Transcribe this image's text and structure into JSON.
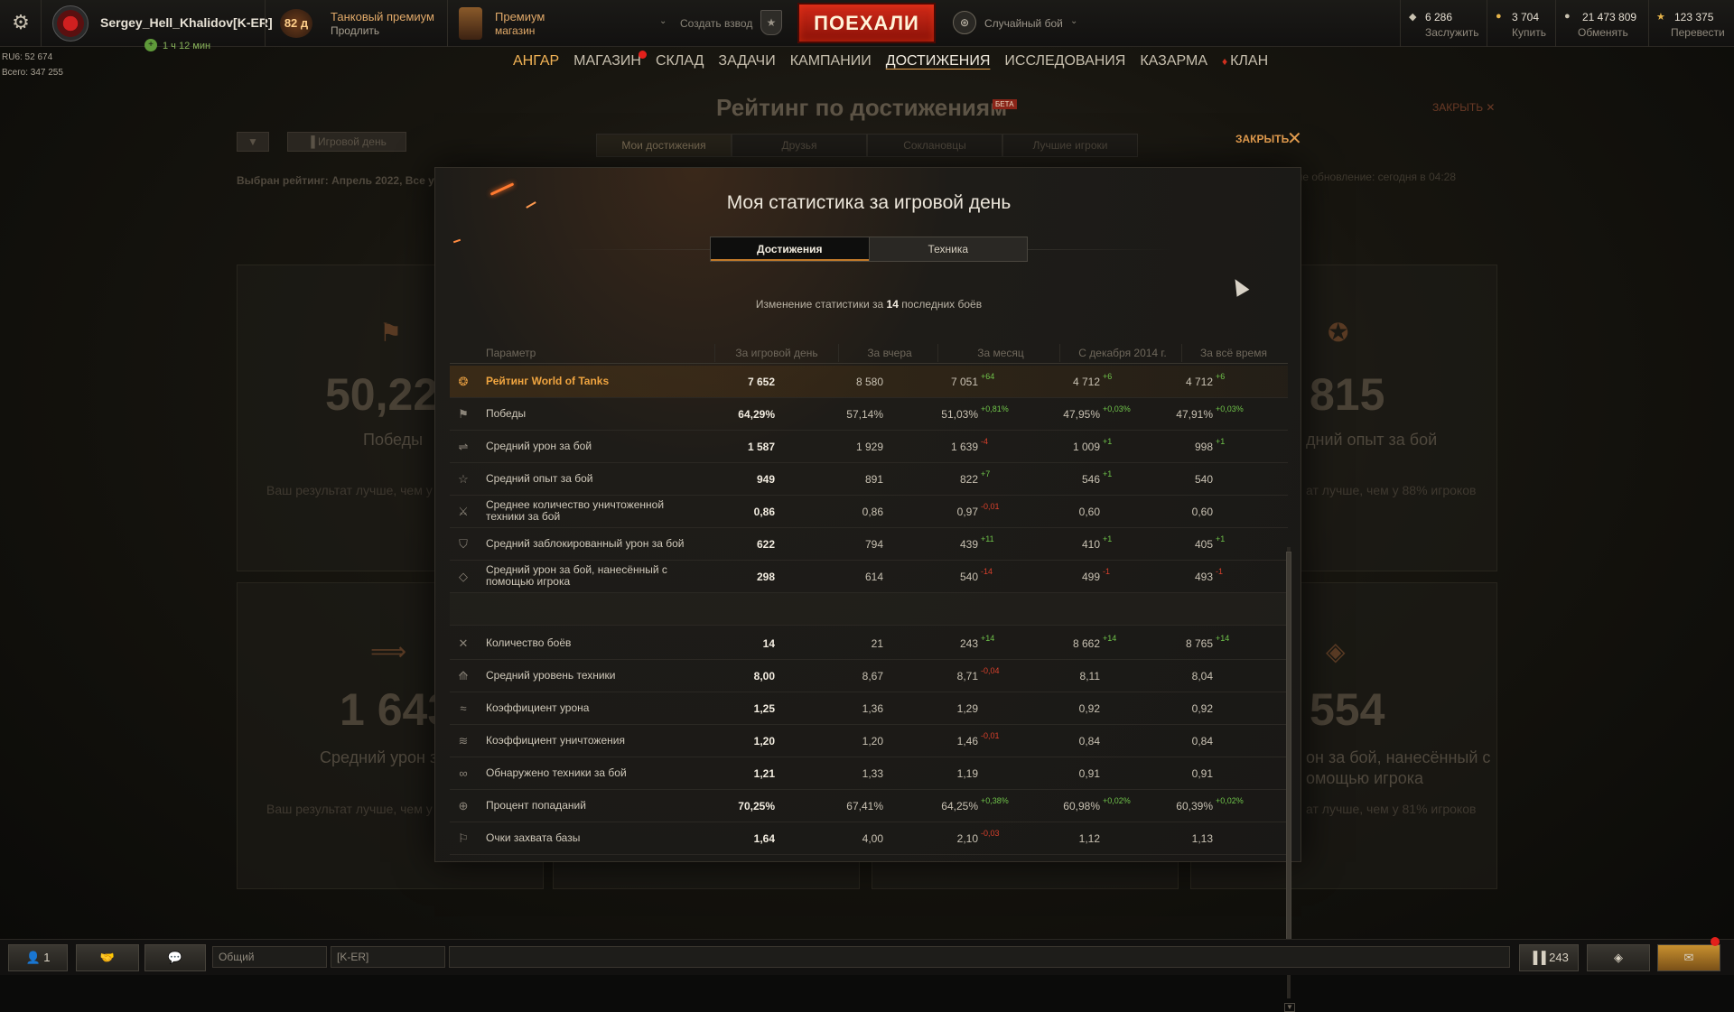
{
  "topbar": {
    "player_name": "Sergey_Hell_Khalidov[K-ER]",
    "premium_timer": "1 ч 12 мин",
    "premium_days": "82 д",
    "premium_title": "Танковый премиум",
    "premium_extend": "Продлить",
    "shop_title": "Премиум",
    "shop_sub": "магазин",
    "platoon_label": "Создать взвод",
    "battle_button": "ПОЕХАЛИ",
    "battle_mode": "Случайный бой",
    "currencies": [
      {
        "icon": "bonds-icon",
        "value": "6 286",
        "action": "Заслужить",
        "color": "#c9c2b0"
      },
      {
        "icon": "gold-icon",
        "value": "3 704",
        "action": "Купить",
        "color": "#e5b34a"
      },
      {
        "icon": "credits-icon",
        "value": "21 473 809",
        "action": "Обменять",
        "color": "#c9c2b0"
      },
      {
        "icon": "free-xp-icon",
        "value": "123 375",
        "action": "Перевести",
        "color": "#e5b34a"
      }
    ]
  },
  "ratings": {
    "line1": "RU6: 52 674",
    "line2": "Всего: 347 255"
  },
  "nav": [
    "АНГАР",
    "МАГАЗИН",
    "СКЛАД",
    "ЗАДАЧИ",
    "КАМПАНИИ",
    "ДОСТИЖЕНИЯ",
    "ИССЛЕДОВАНИЯ",
    "КАЗАРМА",
    "КЛАН"
  ],
  "background_page": {
    "title": "Рейтинг по достижениям",
    "beta": "БЕТА",
    "close": "ЗАКРЫТЬ",
    "day_tab": "Игровой день",
    "subtabs": [
      "Мои достижения",
      "Друзья",
      "Соклановцы",
      "Лучшие игроки"
    ],
    "selected_rating": "Выбран рейтинг: Апрель 2022, Все ур",
    "last_update": "дние обновление: сегодня в 04:28",
    "cards": [
      {
        "number": "50,22%",
        "label": "Победы",
        "sub": "Ваш результат лучше, чем у"
      },
      {
        "number": "815",
        "label": "дний опыт за бой",
        "sub": "ат лучше, чем у 88% игроков"
      },
      {
        "number": "1 643",
        "label": "Средний урон за",
        "sub": "Ваш результат лучше, чем у"
      },
      {
        "number": "554",
        "label": "он за бой, нанесённый с",
        "label2": "омощью игрока",
        "sub": "ат лучше, чем у 81% игроков"
      }
    ]
  },
  "modal": {
    "close_label": "ЗАКРЫТЬ",
    "title": "Моя статистика за игровой день",
    "tabs": [
      "Достижения",
      "Техника"
    ],
    "change_prefix": "Изменение статистики за ",
    "change_count": "14",
    "change_suffix": " последних боёв",
    "columns": [
      "Параметр",
      "За игровой день",
      "За вчера",
      "За месяц",
      "С декабря 2014 г.",
      "За всё время"
    ],
    "rows": [
      {
        "icon": "wot-rating-icon",
        "label": "Рейтинг World of Tanks",
        "day": "7 652",
        "yesterday": "8 580",
        "month": "7 051",
        "month_d": "+64",
        "since": "4 712",
        "since_d": "+6",
        "all": "4 712",
        "all_d": "+6",
        "highlight": true
      },
      {
        "icon": "flag-icon",
        "label": "Победы",
        "day": "64,29%",
        "yesterday": "57,14%",
        "month": "51,03%",
        "month_d": "+0,81%",
        "since": "47,95%",
        "since_d": "+0,03%",
        "all": "47,91%",
        "all_d": "+0,03%"
      },
      {
        "icon": "damage-icon",
        "label": "Средний урон за бой",
        "day": "1 587",
        "yesterday": "1 929",
        "month": "1 639",
        "month_d": "-4",
        "since": "1 009",
        "since_d": "+1",
        "all": "998",
        "all_d": "+1"
      },
      {
        "icon": "star-icon",
        "label": "Средний опыт за бой",
        "day": "949",
        "yesterday": "891",
        "month": "822",
        "month_d": "+7",
        "since": "546",
        "since_d": "+1",
        "all": "540",
        "all_d": ""
      },
      {
        "icon": "destroyed-tank-icon",
        "label": "Среднее количество уничтоженной техники за бой",
        "day": "0,86",
        "yesterday": "0,86",
        "month": "0,97",
        "month_d": "-0,01",
        "since": "0,60",
        "since_d": "",
        "all": "0,60",
        "all_d": ""
      },
      {
        "icon": "shield-icon",
        "label": "Средний заблокированный урон за бой",
        "day": "622",
        "yesterday": "794",
        "month": "439",
        "month_d": "+11",
        "since": "410",
        "since_d": "+1",
        "all": "405",
        "all_d": "+1"
      },
      {
        "icon": "assist-icon",
        "label": "Средний урон за бой, нанесённый с помощью игрока",
        "day": "298",
        "yesterday": "614",
        "month": "540",
        "month_d": "-14",
        "since": "499",
        "since_d": "-1",
        "all": "493",
        "all_d": "-1"
      },
      {
        "icon": "battles-icon",
        "label": "Количество боёв",
        "day": "14",
        "yesterday": "21",
        "month": "243",
        "month_d": "+14",
        "since": "8 662",
        "since_d": "+14",
        "all": "8 765",
        "all_d": "+14"
      },
      {
        "icon": "tier-icon",
        "label": "Средний уровень техники",
        "day": "8,00",
        "yesterday": "8,67",
        "month": "8,71",
        "month_d": "-0,04",
        "since": "8,11",
        "since_d": "",
        "all": "8,04",
        "all_d": ""
      },
      {
        "icon": "damage-ratio-icon",
        "label": "Коэффициент урона",
        "day": "1,25",
        "yesterday": "1,36",
        "month": "1,29",
        "month_d": "",
        "since": "0,92",
        "since_d": "",
        "all": "0,92",
        "all_d": ""
      },
      {
        "icon": "kill-ratio-icon",
        "label": "Коэффициент уничтожения",
        "day": "1,20",
        "yesterday": "1,20",
        "month": "1,46",
        "month_d": "-0,01",
        "since": "0,84",
        "since_d": "",
        "all": "0,84",
        "all_d": ""
      },
      {
        "icon": "spotted-icon",
        "label": "Обнаружено техники за бой",
        "day": "1,21",
        "yesterday": "1,33",
        "month": "1,19",
        "month_d": "",
        "since": "0,91",
        "since_d": "",
        "all": "0,91",
        "all_d": ""
      },
      {
        "icon": "target-icon",
        "label": "Процент попаданий",
        "day": "70,25%",
        "yesterday": "67,41%",
        "month": "64,25%",
        "month_d": "+0,38%",
        "since": "60,98%",
        "since_d": "+0,02%",
        "all": "60,39%",
        "all_d": "+0,02%"
      },
      {
        "icon": "capture-icon",
        "label": "Очки захвата базы",
        "day": "1,64",
        "yesterday": "4,00",
        "month": "2,10",
        "month_d": "-0,03",
        "since": "1,12",
        "since_d": "",
        "all": "1,13",
        "all_d": ""
      }
    ]
  },
  "bottombar": {
    "contacts_count": "1",
    "chat_channel": "Общий",
    "clan_channel": "[K-ER]",
    "online_count": "243"
  }
}
